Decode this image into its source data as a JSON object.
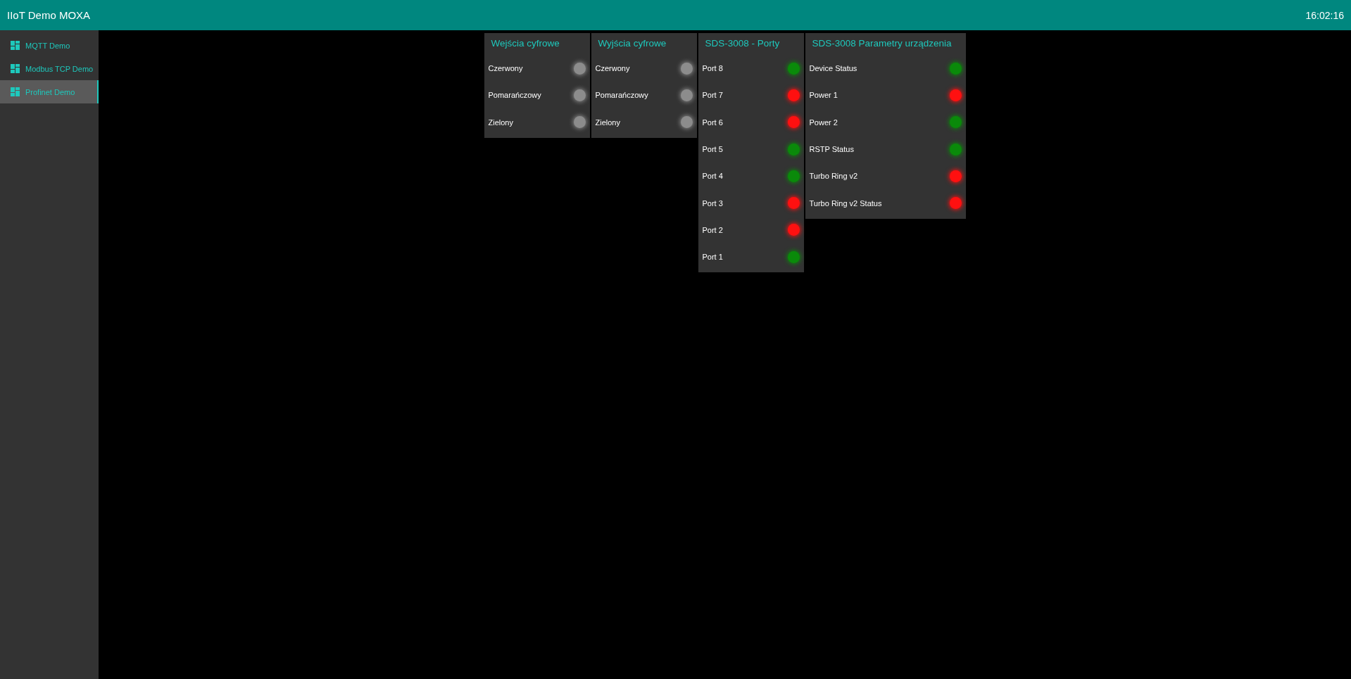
{
  "header": {
    "title": "IIoT Demo MOXA",
    "time": "16:02:16"
  },
  "sidebar": {
    "items": [
      {
        "label": "MQTT Demo",
        "selected": false
      },
      {
        "label": "Modbus TCP Demo",
        "selected": false
      },
      {
        "label": "Profinet Demo",
        "selected": true
      }
    ]
  },
  "panels": [
    {
      "title": "Wejścia cyfrowe",
      "rows": [
        {
          "label": "Czerwony",
          "color": "#8c8c8c"
        },
        {
          "label": "Pomarańczowy",
          "color": "#8c8c8c"
        },
        {
          "label": "Zielony",
          "color": "#8c8c8c"
        }
      ]
    },
    {
      "title": "Wyjścia cyfrowe",
      "rows": [
        {
          "label": "Czerwony",
          "color": "#8c8c8c"
        },
        {
          "label": "Pomarańczowy",
          "color": "#8c8c8c"
        },
        {
          "label": "Zielony",
          "color": "#8c8c8c"
        }
      ]
    },
    {
      "title": "SDS-3008 - Porty",
      "rows": [
        {
          "label": "Port 8",
          "color": "#0a8a0a"
        },
        {
          "label": "Port 7",
          "color": "#ff1010"
        },
        {
          "label": "Port 6",
          "color": "#ff1010"
        },
        {
          "label": "Port 5",
          "color": "#0a8a0a"
        },
        {
          "label": "Port 4",
          "color": "#0a8a0a"
        },
        {
          "label": "Port 3",
          "color": "#ff1010"
        },
        {
          "label": "Port 2",
          "color": "#ff1010"
        },
        {
          "label": "Port 1",
          "color": "#0a8a0a"
        }
      ]
    },
    {
      "title": "SDS-3008 Parametry urządzenia",
      "rows": [
        {
          "label": "Device Status",
          "color": "#0a8a0a"
        },
        {
          "label": "Power 1",
          "color": "#ff1010"
        },
        {
          "label": "Power 2",
          "color": "#0a8a0a"
        },
        {
          "label": "RSTP Status",
          "color": "#0a8a0a"
        },
        {
          "label": "Turbo Ring v2",
          "color": "#ff1010"
        },
        {
          "label": "Turbo Ring v2 Status",
          "color": "#ff1010"
        }
      ]
    }
  ]
}
